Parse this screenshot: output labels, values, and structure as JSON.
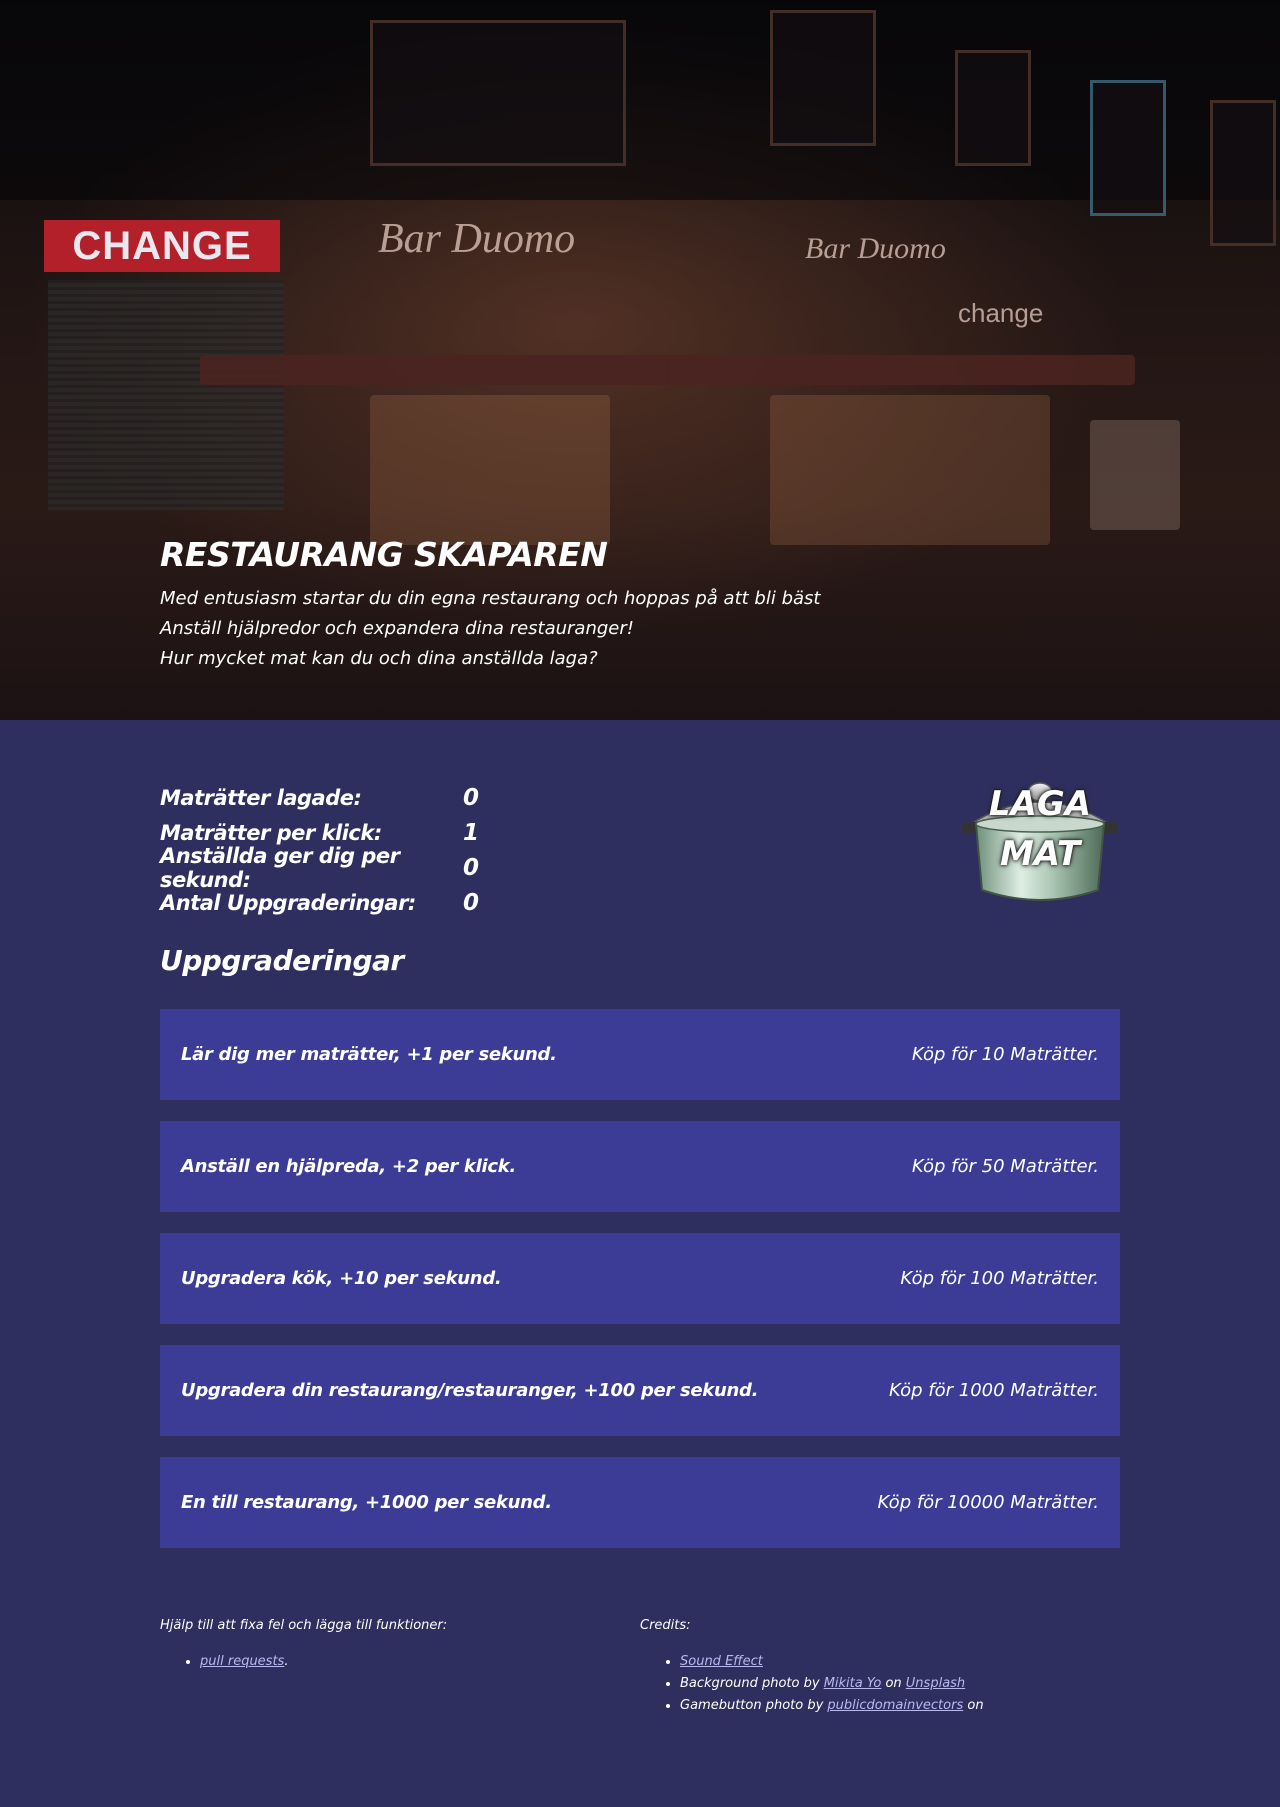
{
  "hero": {
    "title": "RESTAURANG SKAPAREN",
    "lines": [
      "Med entusiasm startar du din egna restaurang och hoppas på att bli bäst",
      "Anställ hjälpredor och expandera dina restauranger!",
      "Hur mycket mat kan du och dina anställda laga?"
    ],
    "photo_signs": [
      "CHANGE",
      "Bar Duomo",
      "Bar Duomo",
      "change"
    ]
  },
  "stats": [
    {
      "label": "Maträtter lagade:",
      "value": "0"
    },
    {
      "label": "Maträtter per klick:",
      "value": "1"
    },
    {
      "label": "Anställda ger dig per sekund:",
      "value": "0"
    },
    {
      "label": "Antal Uppgraderingar:",
      "value": "0"
    }
  ],
  "cook_button": {
    "line1": "LAGA",
    "line2": "MAT"
  },
  "upgrades_heading": "Uppgraderingar",
  "upgrades": [
    {
      "desc": "Lär dig mer maträtter, +1 per sekund.",
      "cost": "Köp för 10 Maträtter."
    },
    {
      "desc": "Anställ en hjälpreda, +2 per klick.",
      "cost": "Köp för 50 Maträtter."
    },
    {
      "desc": "Upgradera kök, +10 per sekund.",
      "cost": "Köp för 100 Maträtter."
    },
    {
      "desc": "Upgradera din restaurang/restauranger, +100 per sekund.",
      "cost": "Köp för 1000 Maträtter."
    },
    {
      "desc": "En till restaurang, +1000 per sekund.",
      "cost": "Köp för 10000 Maträtter."
    }
  ],
  "footer": {
    "help_heading": "Hjälp till att fixa fel och lägga till funktioner:",
    "help_link": "pull requests",
    "help_suffix": ".",
    "credits_heading": "Credits:",
    "sound_link": "Sound Effect",
    "bg_prefix": "Background photo by ",
    "bg_author": "Mikita Yo",
    "on1": " on ",
    "bg_site": "Unsplash",
    "gb_prefix": "Gamebutton photo by ",
    "gb_author": "publicdomainvectors",
    "on2": " on"
  }
}
